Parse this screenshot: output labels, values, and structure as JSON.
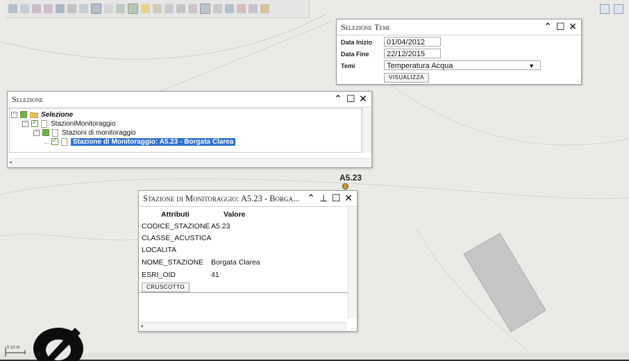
{
  "map": {
    "station_label": "A5.23",
    "scale_label": "5 10 m"
  },
  "selezione_temi": {
    "title": "Selezione Temi",
    "data_inizio_label": "Data Inizio",
    "data_inizio_value": "01/04/2012",
    "data_fine_label": "Data Fine",
    "data_fine_value": "22/12/2015",
    "temi_label": "Temi",
    "temi_value": "Temperatura Acqua",
    "visualizza_label": "VISUALIZZA"
  },
  "selezione": {
    "title": "Selezione",
    "tree": [
      {
        "label": "Selezione"
      },
      {
        "label": "StazioniMonitoraggio"
      },
      {
        "label": "Stazioni di monitoraggio"
      },
      {
        "label": "Stazione di Monitoraggio: A5.23 - Borgata Clarea"
      }
    ]
  },
  "stazione_popup": {
    "title": "Stazione di Monitoraggio: A5.23 - Borga...",
    "col_attributi": "Attributi",
    "col_valore": "Valore",
    "rows": [
      {
        "attr": "CODICE_STAZIONE",
        "value": "A5.23"
      },
      {
        "attr": "CLASSE_ACUSTICA",
        "value": ""
      },
      {
        "attr": "LOCALITA",
        "value": ""
      },
      {
        "attr": "NOME_STAZIONE",
        "value": "Borgata Clarea"
      },
      {
        "attr": "ESRI_OID",
        "value": "41"
      }
    ],
    "cruscotto_label": "CRUSCOTTO"
  }
}
